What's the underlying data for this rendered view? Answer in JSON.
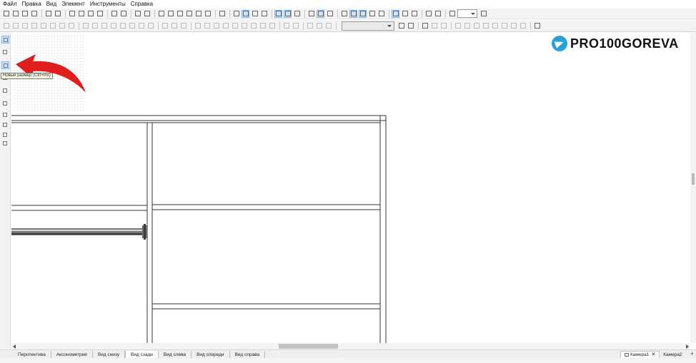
{
  "menu": [
    "Файл",
    "Правка",
    "Вид",
    "Элемент",
    "Инструменты",
    "Справка"
  ],
  "tooltip": "Новый размер (Ctrl+Ins)",
  "watermark": {
    "text": "PRO100GOREVA",
    "icon": "telegram-icon",
    "icon_color": "#2a9fd8"
  },
  "toolbar1": {
    "groups": [
      [
        "new-file-icon",
        "open-folder-icon",
        "save-icon",
        "save-as-icon"
      ],
      [
        "print-icon",
        "print-preview-icon"
      ],
      [
        "cut-icon",
        "copy-icon",
        "paste-icon",
        "delete-icon"
      ],
      [
        "undo-icon",
        "redo-icon"
      ],
      [
        "library-icon",
        "element-settings-icon"
      ],
      [
        "report-icon",
        "search-icon",
        "duplicate-icon",
        "mirror-icon",
        "material-icon",
        "bulb-icon"
      ],
      [
        "sheet-icon"
      ],
      [
        "view-3d-icon",
        "view-frame-icon",
        "view-solid-icon",
        "view-texture-icon"
      ],
      [
        "view-a-icon",
        "view-b-icon",
        "view-c-icon"
      ],
      [
        "panels-icon",
        "snap-icon",
        "light-icon"
      ],
      [
        "tag-icon",
        "dimension-icon",
        "ruler-icon",
        "grid-icon",
        "eye-icon"
      ],
      [
        "nav-a-icon",
        "nav-b-icon",
        "nav-c-icon"
      ],
      [
        "magnet-icon",
        "target-icon"
      ],
      [
        "zoom-icon"
      ]
    ],
    "active": [
      "view-frame-icon",
      "view-a-icon",
      "view-b-icon",
      "snap-icon",
      "dimension-icon",
      "ruler-icon",
      "nav-a-icon"
    ],
    "zoom_value": ""
  },
  "toolbar2": {
    "groups": [
      [
        "align-left-icon",
        "align-center-icon",
        "align-right-icon",
        "align-top-icon",
        "align-middle-icon",
        "align-bottom-icon",
        "align-front-icon",
        "align-back-icon"
      ],
      [
        "distribute-h-icon",
        "distribute-v-icon",
        "distribute-d-icon",
        "space-h-icon",
        "space-v-icon",
        "space-d-icon",
        "size-w-icon",
        "size-h-icon"
      ],
      [
        "move-a-icon",
        "move-b-icon",
        "move-c-icon"
      ],
      [
        "stack-a-icon",
        "stack-b-icon",
        "stack-c-icon",
        "stack-d-icon",
        "stack-e-icon",
        "stack-f-icon",
        "stack-g-icon",
        "stack-h-icon",
        "stack-i-icon"
      ],
      [
        "group-a-icon",
        "group-b-icon"
      ],
      [
        "lock-a-icon",
        "lock-b-icon",
        "lock-c-icon"
      ]
    ],
    "combo_value": "",
    "groups_after": [
      [
        "filter-icon",
        "paint-icon"
      ],
      [
        "snap-grid-icon",
        "move-icon",
        "rotate-icon"
      ],
      [
        "copy-move-icon",
        "transform-a-icon",
        "transform-b-icon",
        "transform-c-icon",
        "transform-d-icon",
        "transform-e-icon",
        "transform-f-icon",
        "transform-g-icon"
      ],
      [
        "stop-icon"
      ]
    ]
  },
  "left_tools": [
    "pointer-icon",
    "dimension-tool-icon",
    "new-dimension-icon",
    "pencil-icon",
    "copy-tool-icon",
    "shelf-a-icon",
    "shelf-b-icon",
    "shelf-c-icon",
    "shelf-d-icon",
    "zoom-tool-icon"
  ],
  "view_tabs": [
    "Перспектива",
    "Аксонометрия",
    "Вид снизу",
    "Вид сзади",
    "Вид слева",
    "Вид спереди",
    "Вид справа"
  ],
  "active_view_tab": "Вид сзади",
  "camera_tabs": [
    "Камера1",
    "Камера2"
  ],
  "active_camera_tab": "Камера1",
  "colors": {
    "accent_red_arrow": "#e01e1e",
    "active_button": "#cfe3f6",
    "telegram": "#2a9fd8"
  }
}
